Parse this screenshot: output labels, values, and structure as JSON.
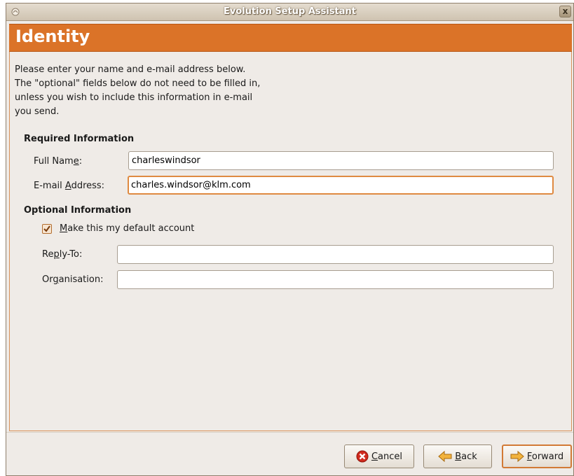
{
  "window": {
    "title": "Evolution Setup Assistant",
    "close_glyph": "x"
  },
  "page": {
    "heading": "Identity",
    "intro_lines": [
      "Please enter your name and e-mail address below.",
      "The \"optional\" fields below do not need to be filled in,",
      "unless you wish to include this information in e-mail",
      "you send."
    ]
  },
  "required": {
    "heading": "Required Information",
    "full_name_label": {
      "before": "Full Nam",
      "mnemonic": "e",
      "after": ":"
    },
    "full_name_value": "charleswindsor",
    "email_label": {
      "before": "E-mail ",
      "mnemonic": "A",
      "after": "ddress:"
    },
    "email_value": "charles.windsor@klm.com"
  },
  "optional": {
    "heading": "Optional Information",
    "default_account": {
      "checked": true,
      "mnemonic": "M",
      "after": "ake this my default account"
    },
    "reply_to_label": {
      "before": "Re",
      "mnemonic": "p",
      "after": "ly-To:"
    },
    "reply_to_value": "",
    "organisation_label": {
      "before": "Or",
      "mnemonic": "g",
      "after": "anisation:"
    },
    "organisation_value": ""
  },
  "buttons": {
    "cancel": {
      "mnemonic": "C",
      "after": "ancel",
      "icon": "cancel-icon"
    },
    "back": {
      "mnemonic": "B",
      "after": "ack",
      "icon": "back-arrow-icon"
    },
    "forward": {
      "mnemonic": "F",
      "after": "orward",
      "icon": "forward-arrow-icon"
    }
  },
  "colors": {
    "accent_orange": "#db7328",
    "window_bg": "#efebe7",
    "focus_border": "#df8a41"
  }
}
